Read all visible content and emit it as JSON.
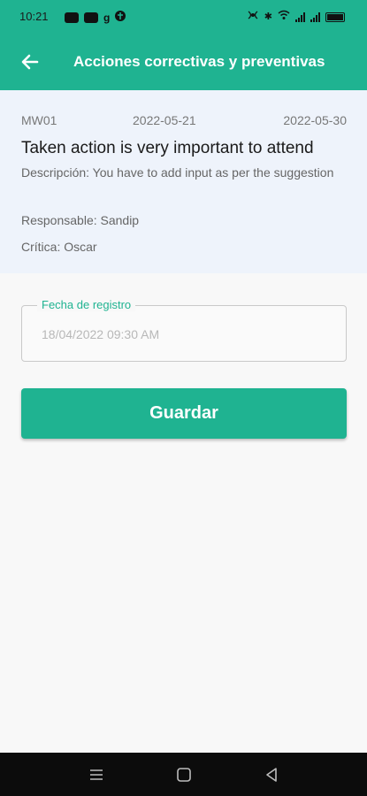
{
  "status_bar": {
    "time": "10:21",
    "left_icons": [
      "notification-pill-icon",
      "notification-pill-icon",
      "g-app-icon",
      "shield-app-icon"
    ],
    "right_icons": [
      "nfc-icon",
      "bluetooth-icon",
      "wifi-icon",
      "signal-icon",
      "signal-icon",
      "battery-icon"
    ],
    "battery_label": "100"
  },
  "app_bar": {
    "title": "Acciones correctivas y preventivas",
    "back_icon": "arrow-left-icon"
  },
  "card": {
    "code": "MW01",
    "date_start": "2022-05-21",
    "date_end": "2022-05-30",
    "title": "Taken action is very important to attend",
    "description": "Descripción: You have to add input as per the suggestion",
    "responsible": "Responsable: Sandip",
    "critic": "Crítica: Oscar"
  },
  "form": {
    "date_field_label": "Fecha de registro",
    "date_field_placeholder": "18/04/2022 09:30 AM"
  },
  "actions": {
    "save_label": "Guardar"
  },
  "nav_bar": {
    "icons": [
      "menu-icon",
      "home-icon",
      "back-triangle-icon"
    ]
  },
  "colors": {
    "primary": "#1fb391",
    "card_background": "#eef3fb",
    "page_background": "#f8f8f8",
    "nav_background": "#0c0c0c"
  }
}
